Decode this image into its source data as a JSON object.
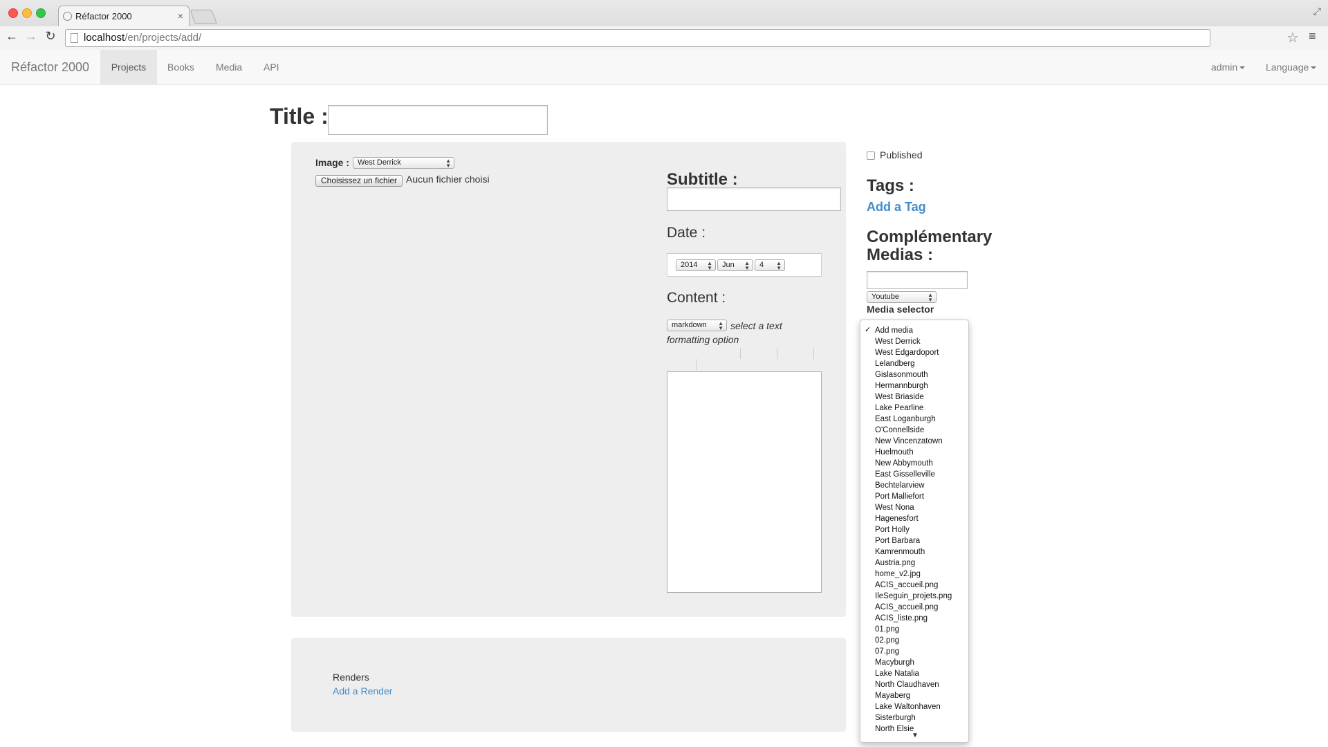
{
  "browser": {
    "tab_title": "Réfactor 2000",
    "url_host": "localhost",
    "url_path": "/en/projects/add/"
  },
  "navbar": {
    "brand": "Réfactor 2000",
    "items": [
      "Projects",
      "Books",
      "Media",
      "API"
    ],
    "active": "Projects",
    "user": "admin",
    "language": "Language"
  },
  "form": {
    "title_label": "Title :",
    "image_label": "Image :",
    "image_select": "West Derrick",
    "file_button": "Choisissez un fichier",
    "file_status": "Aucun fichier choisi",
    "subtitle_label": "Subtitle :",
    "date_label": "Date :",
    "date_year": "2014",
    "date_month": "Jun",
    "date_day": "4",
    "content_label": "Content :",
    "format_select": "markdown",
    "format_hint": "select a text formatting option",
    "renders_label": "Renders",
    "add_render": "Add a Render"
  },
  "sidebar": {
    "published_label": "Published",
    "published_checked": false,
    "tags_heading": "Tags :",
    "add_tag": "Add a Tag",
    "complementary_heading": "Complémentary Medias :",
    "media_type_select": "Youtube",
    "media_selector_label": "Media selector",
    "media_options": [
      "Add media",
      "West Derrick",
      "West Edgardoport",
      "Lelandberg",
      "Gislasonmouth",
      "Hermannburgh",
      "West Briaside",
      "Lake Pearline",
      "East Loganburgh",
      "O'Connellside",
      "New Vincenzatown",
      "Huelmouth",
      "New Abbymouth",
      "East Gisselleville",
      "Bechtelarview",
      "Port Malliefort",
      "West Nona",
      "Hagenesfort",
      "Port Holly",
      "Port Barbara",
      "Kamrenmouth",
      "Austria.png",
      "home_v2.jpg",
      "ACIS_accueil.png",
      "IleSeguin_projets.png",
      "ACIS_accueil.png",
      "ACIS_liste.png",
      "01.png",
      "02.png",
      "07.png",
      "Macyburgh",
      "Lake Natalia",
      "North Claudhaven",
      "Mayaberg",
      "Lake Waltonhaven",
      "Sisterburgh",
      "North Elsie"
    ],
    "media_selected": "Add media",
    "check_glyph": "✓",
    "more_glyph": "▼"
  }
}
